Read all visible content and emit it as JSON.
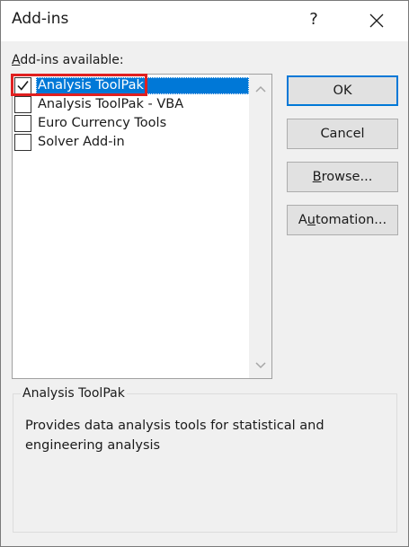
{
  "window": {
    "title": "Add-ins",
    "help_label": "?"
  },
  "list": {
    "label_accel": "A",
    "label_rest": "dd-ins available:",
    "items": [
      {
        "label": "Analysis ToolPak",
        "checked": true,
        "selected": true
      },
      {
        "label": "Analysis ToolPak - VBA",
        "checked": false,
        "selected": false
      },
      {
        "label": "Euro Currency Tools",
        "checked": false,
        "selected": false
      },
      {
        "label": "Solver Add-in",
        "checked": false,
        "selected": false
      }
    ]
  },
  "buttons": {
    "ok": "OK",
    "cancel": "Cancel",
    "browse_accel": "B",
    "browse_rest": "rowse...",
    "automation_pre": "A",
    "automation_accel": "u",
    "automation_rest": "tomation..."
  },
  "description": {
    "title": "Analysis ToolPak",
    "text": "Provides data analysis tools for statistical and engineering analysis"
  },
  "colors": {
    "selection": "#0078d7",
    "highlight_border": "#e02020",
    "default_button_border": "#0078d7"
  },
  "icons": {
    "close": "close-icon",
    "check": "check-icon",
    "scroll_up": "chevron-up-icon",
    "scroll_down": "chevron-down-icon"
  }
}
